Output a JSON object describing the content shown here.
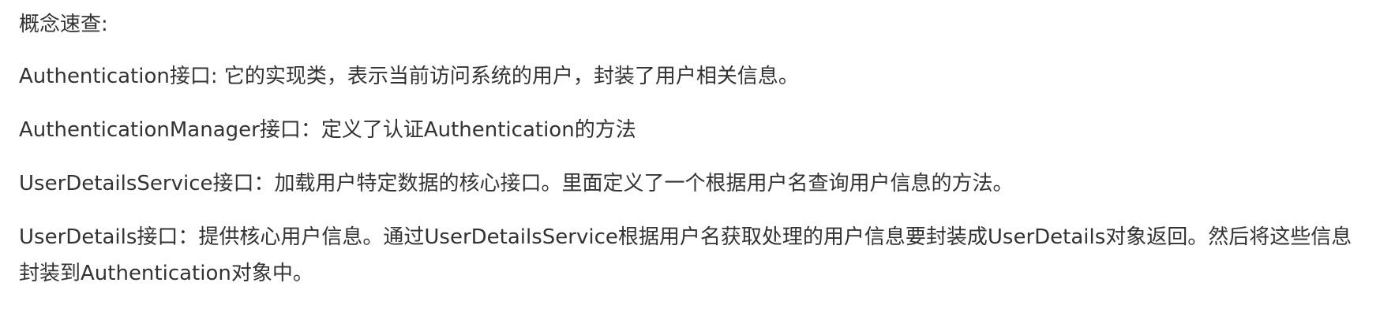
{
  "document": {
    "heading": "概念速查:",
    "paragraphs": [
      "Authentication接口: 它的实现类，表示当前访问系统的用户，封装了用户相关信息。",
      "AuthenticationManager接口：定义了认证Authentication的方法",
      "UserDetailsService接口：加载用户特定数据的核心接口。里面定义了一个根据用户名查询用户信息的方法。",
      "UserDetails接口：提供核心用户信息。通过UserDetailsService根据用户名获取处理的用户信息要封装成UserDetails对象返回。然后将这些信息封装到Authentication对象中。"
    ]
  }
}
